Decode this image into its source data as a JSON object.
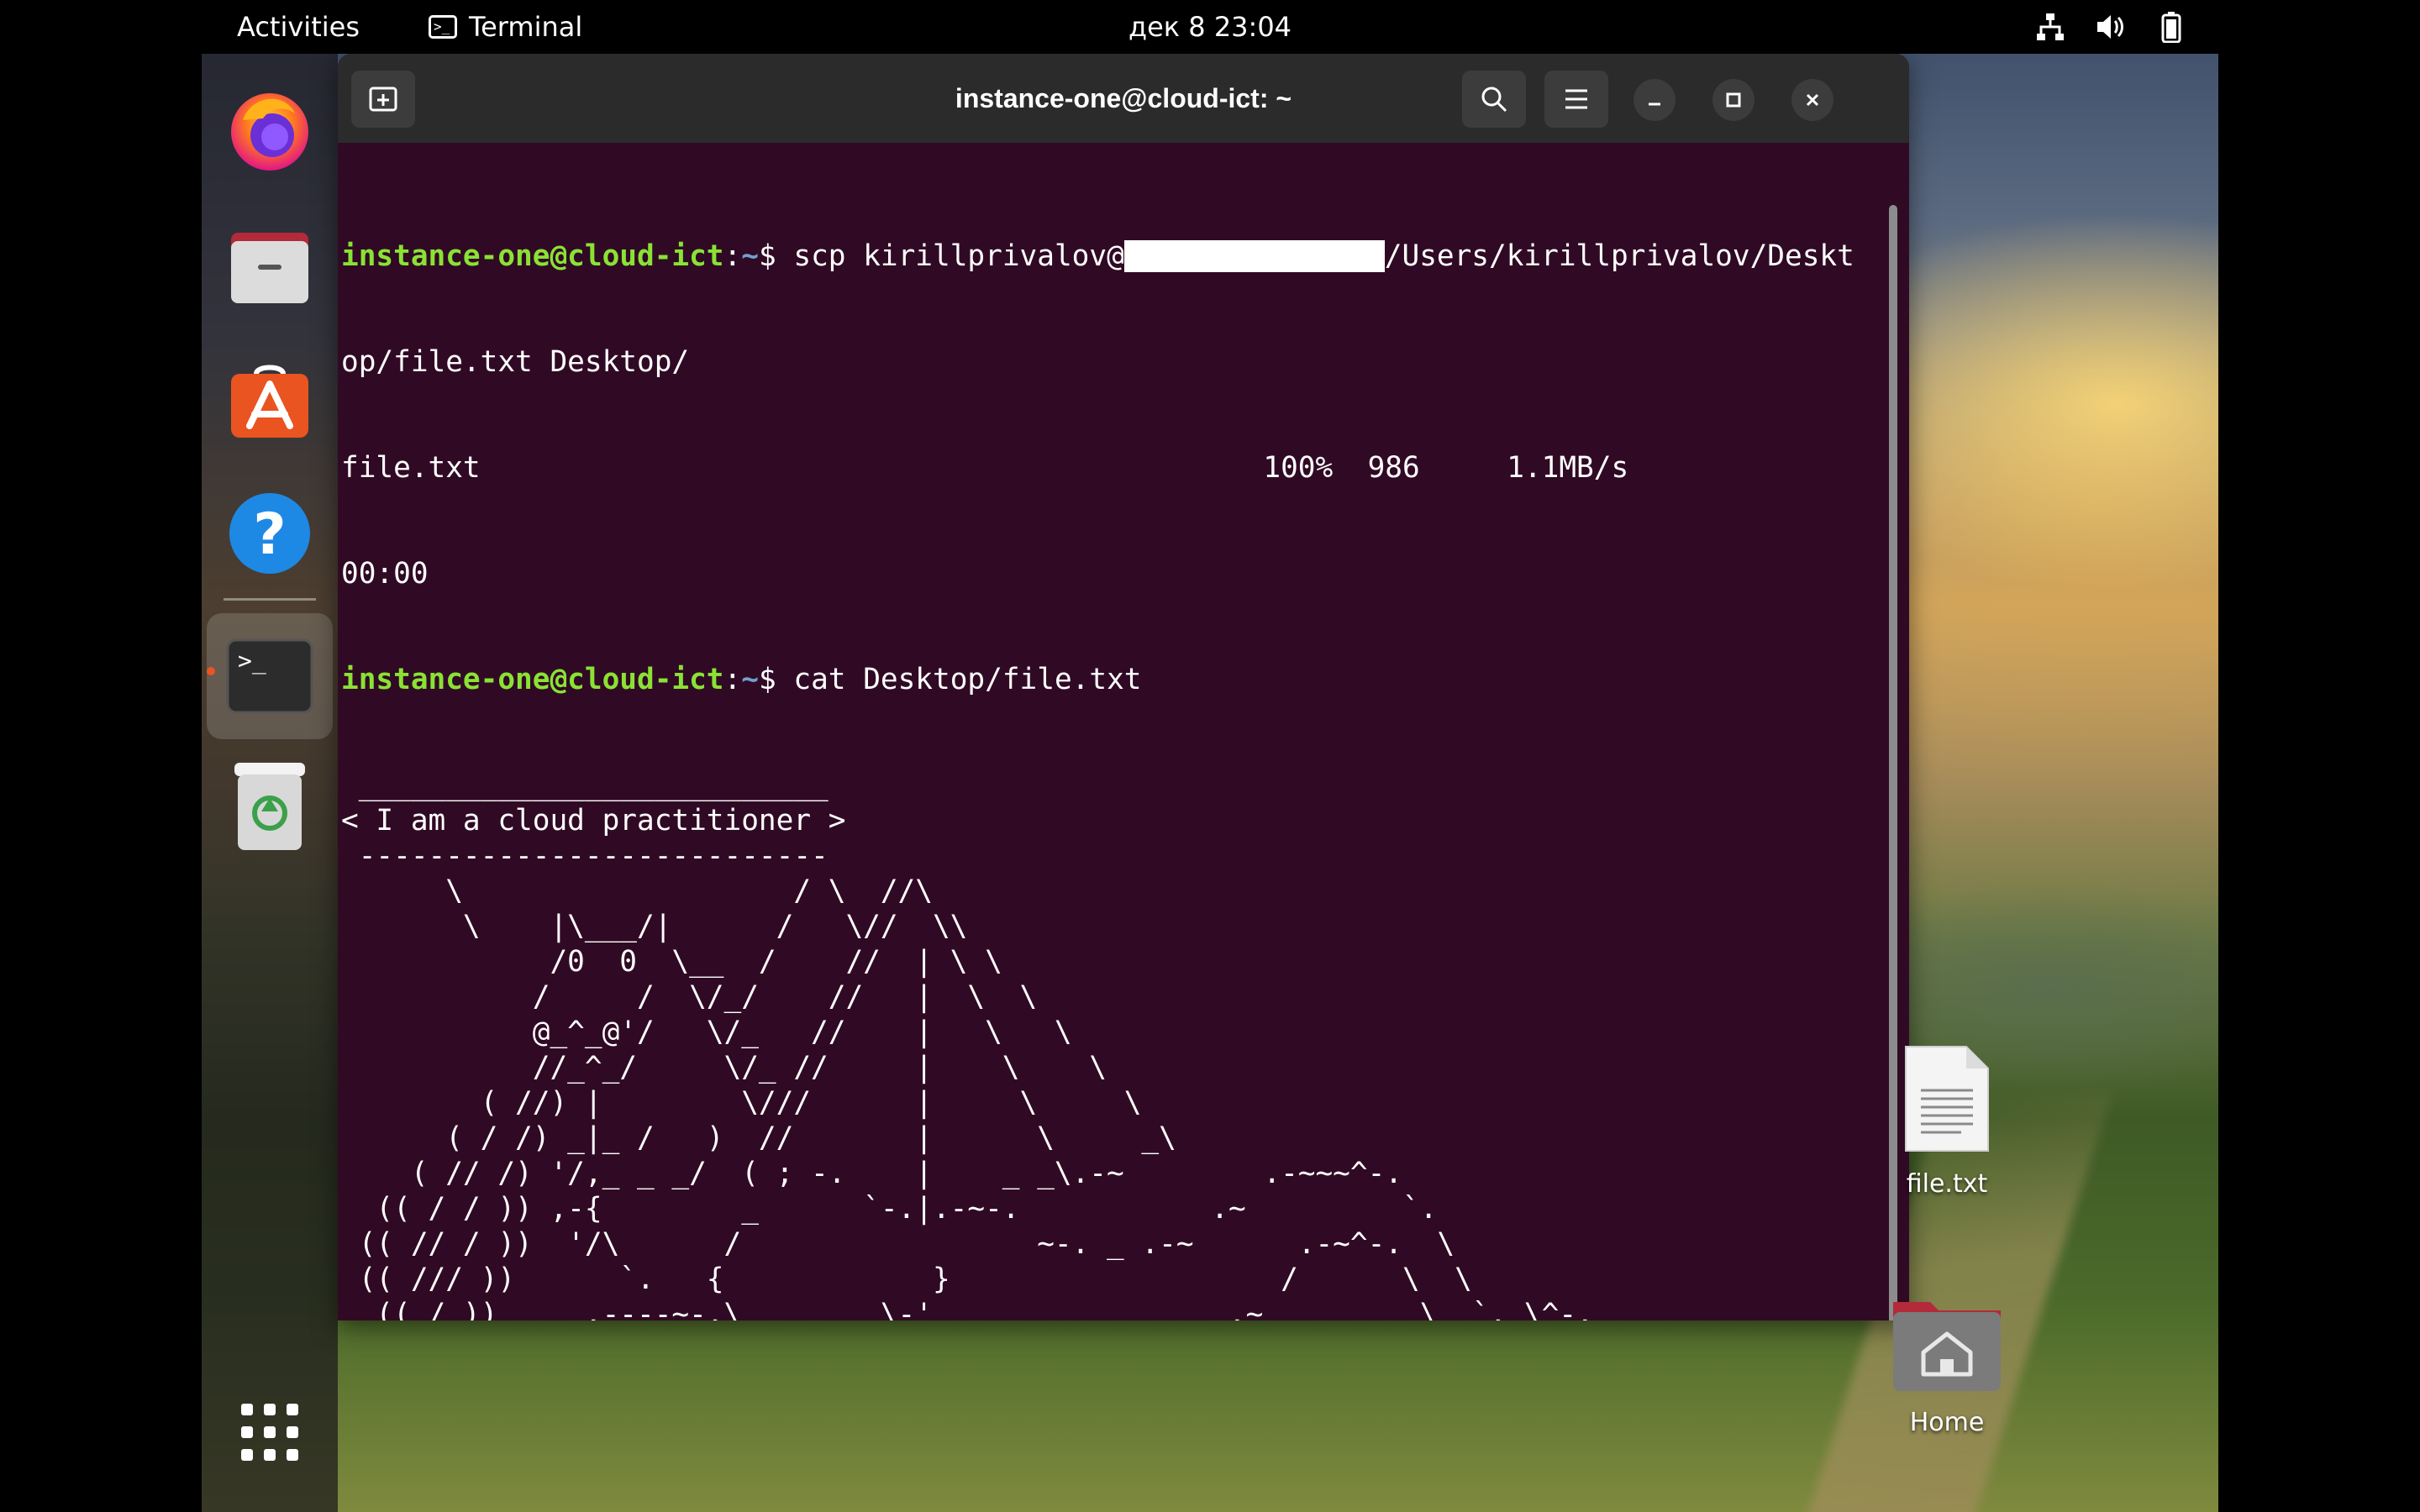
{
  "topbar": {
    "activities": "Activities",
    "app_name": "Terminal",
    "clock": "дек 8  23:04",
    "tray_icons": [
      "network-icon",
      "volume-icon",
      "battery-icon"
    ]
  },
  "dock": {
    "items": [
      "firefox-icon",
      "files-icon",
      "software-icon",
      "help-icon",
      "terminal-icon",
      "trash-icon",
      "app-grid-icon"
    ],
    "running_indicator_color": "#e95420"
  },
  "terminal": {
    "title": "instance-one@cloud-ict: ~",
    "background": "#300a24",
    "prompt_user": "instance-one@cloud-ict",
    "prompt_path": "~",
    "prompt_symbol": "$",
    "command1_pre": " scp kirillprivalov@",
    "command1_post": "/Users/kirillprivalov/Deskt",
    "command1_wrap": "op/file.txt Desktop/",
    "transfer_line": "file.txt                                             100%  986     1.1MB/s",
    "transfer_time": "00:00",
    "command2": " cat Desktop/file.txt",
    "output": [
      " ___________________________",
      "< I am a cloud practitioner >",
      " ---------------------------",
      "      \\                   / \\  //\\",
      "       \\    |\\___/|      /   \\//  \\\\",
      "            /0  0  \\__  /    //  | \\ \\",
      "           /     /  \\/_/    //   |  \\  \\",
      "           @_^_@'/   \\/_   //    |   \\   \\",
      "           //_^_/     \\/_ //     |    \\    \\",
      "        ( //) |        \\///      |     \\     \\",
      "      ( / /) _|_ /   )  //       |      \\     _\\",
      "    ( // /) '/,_ _ _/  ( ; -.    |    _ _\\.-~        .-~~~^-.",
      "  (( / / )) ,-{        _      `-.|.-~-.           .~         `.",
      " (( // / ))  '/\\      /                 ~-. _ .-~      .-~^-.  \\",
      " (( /// ))      `.   {            }                   /      \\  \\",
      "  (( / ))     .----~-.\\        \\-'                 .~         \\  `. \\^-.",
      "             ///.----..>        \\             _ -~             `.  ^-`  ^-_",
      "               ///-._ _ _ _ _ _ _}^ - - - - ~                     ~-- ,.-~",
      "                                                                  /.-~"
    ]
  },
  "desktop": {
    "icons": [
      {
        "label": "file.txt",
        "icon": "text-file-icon"
      },
      {
        "label": "Home",
        "icon": "home-folder-icon"
      }
    ]
  }
}
